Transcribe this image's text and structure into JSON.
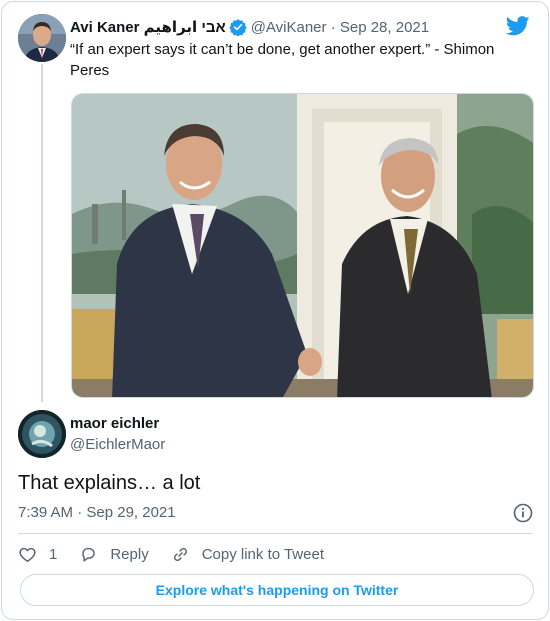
{
  "parent_tweet": {
    "display_name": "Avi Kaner אבי ابراهيم",
    "handle_date": "@AviKaner · Sep 28, 2021",
    "text": "“If an expert says it can’t be done, get another expert.” - Shimon Peres"
  },
  "reply": {
    "display_name": "maor eichler",
    "handle": "@EichlerMaor",
    "text": "That explains… a lot",
    "timestamp": "7:39 AM · Sep 29, 2021"
  },
  "actions": {
    "like_count": "1",
    "reply_label": "Reply",
    "copy_link_label": "Copy link to Tweet"
  },
  "footer": {
    "explore_label": "Explore what's happening on Twitter"
  },
  "colors": {
    "accent": "#1d9bf0",
    "text_primary": "#0f1419",
    "text_secondary": "#536471",
    "border": "#cfd9de"
  },
  "icons": [
    "verified-badge-icon",
    "twitter-bird-icon",
    "info-icon",
    "heart-icon",
    "reply-icon",
    "link-icon"
  ]
}
